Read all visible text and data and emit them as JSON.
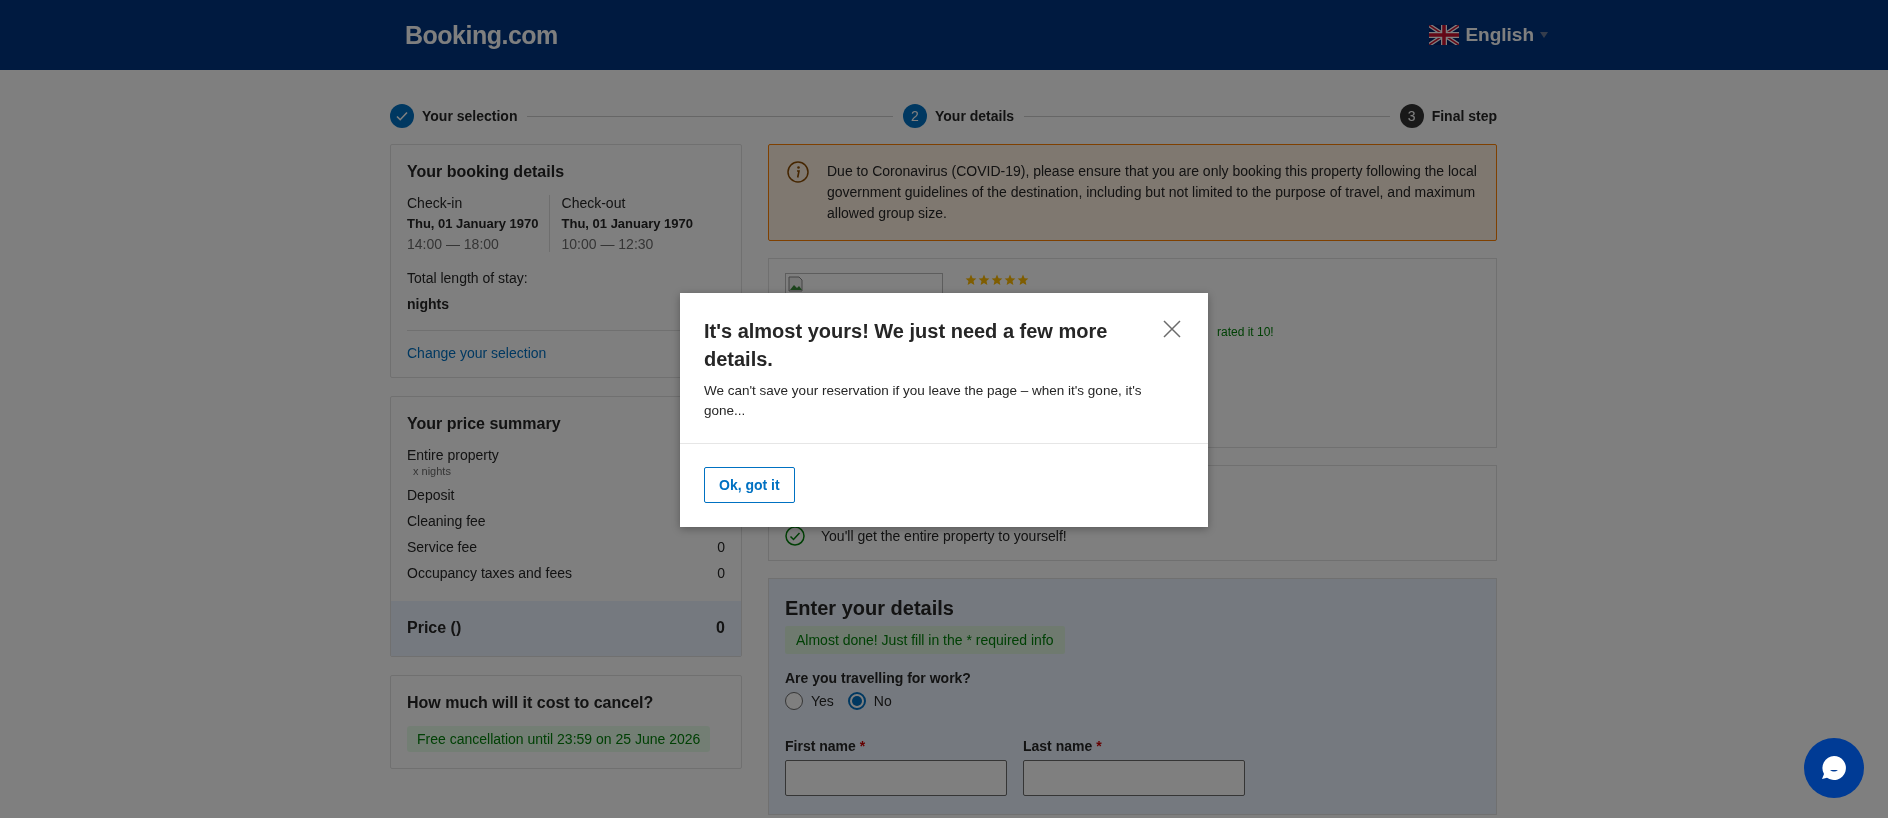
{
  "header": {
    "logo": "Booking.com",
    "language": "English"
  },
  "steps": [
    {
      "kind": "done",
      "label": "Your selection"
    },
    {
      "kind": "current",
      "number": "2",
      "label": "Your details"
    },
    {
      "kind": "todo",
      "number": "3",
      "label": "Final step"
    }
  ],
  "booking_details": {
    "title": "Your booking details",
    "checkin": {
      "label": "Check-in",
      "date": "Thu, 01 January 1970",
      "time": "14:00 — 18:00"
    },
    "checkout": {
      "label": "Check-out",
      "date": "Thu, 01 January 1970",
      "time": "10:00 — 12:30"
    },
    "stay_label": "Total length of stay:",
    "stay_value": "nights",
    "change_link": "Change your selection"
  },
  "price_summary": {
    "title": "Your price summary",
    "rows": [
      {
        "label": "Entire property",
        "sublabel": "x nights",
        "value": ""
      },
      {
        "label": "Deposit",
        "sublabel": "",
        "value": ""
      },
      {
        "label": "Cleaning fee",
        "sublabel": "",
        "value": ""
      },
      {
        "label": "Service fee",
        "sublabel": "",
        "value": "0"
      },
      {
        "label": "Occupancy taxes and fees",
        "sublabel": "",
        "value": "0"
      }
    ],
    "total_label": "Price ()",
    "total_value": "0"
  },
  "cancel": {
    "title": "How much will it cost to cancel?",
    "badge": "Free cancellation until 23:59 on 25 June 2026"
  },
  "covid_alert": {
    "text": "Due to Coronavirus (COVID-19), please ensure that you are only booking this property following the local government guidelines of the destination, including but not limited to the purpose of travel, and maximum allowed group size."
  },
  "property": {
    "stars": 5,
    "review": "rated it 10!"
  },
  "perks": [
    {
      "text": "You'll get the entire property to yourself!"
    }
  ],
  "details_form": {
    "title": "Enter your details",
    "notice": "Almost done! Just fill in the * required info",
    "question": "Are you travelling for work?",
    "options": [
      {
        "label": "Yes",
        "selected": false
      },
      {
        "label": "No",
        "selected": true
      }
    ],
    "fields": [
      {
        "label": "First name",
        "mark": "*"
      },
      {
        "label": "Last name",
        "mark": "*"
      }
    ]
  },
  "modal": {
    "title": "It's almost yours! We just need a few more details.",
    "text": "We can't save your reservation if you leave the page – when it's gone, it's gone...",
    "button": "Ok, got it"
  }
}
